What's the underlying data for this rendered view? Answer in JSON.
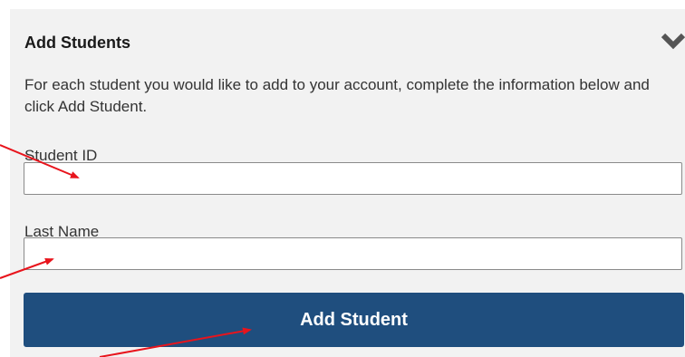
{
  "panel": {
    "title": "Add Students",
    "collapse_icon": "chevron-down-icon",
    "description": "For each student you would like to add to your account, complete the information below and click Add Student."
  },
  "form": {
    "student_id": {
      "label": "Student ID",
      "value": "",
      "placeholder": ""
    },
    "last_name": {
      "label": "Last Name",
      "value": "",
      "placeholder": ""
    },
    "submit_label": "Add Student"
  },
  "colors": {
    "panel_background": "#f2f2f2",
    "button_background": "#1f4e7e",
    "button_text": "#ffffff",
    "annotation_arrow": "#e8141c",
    "chevron": "#555555"
  }
}
